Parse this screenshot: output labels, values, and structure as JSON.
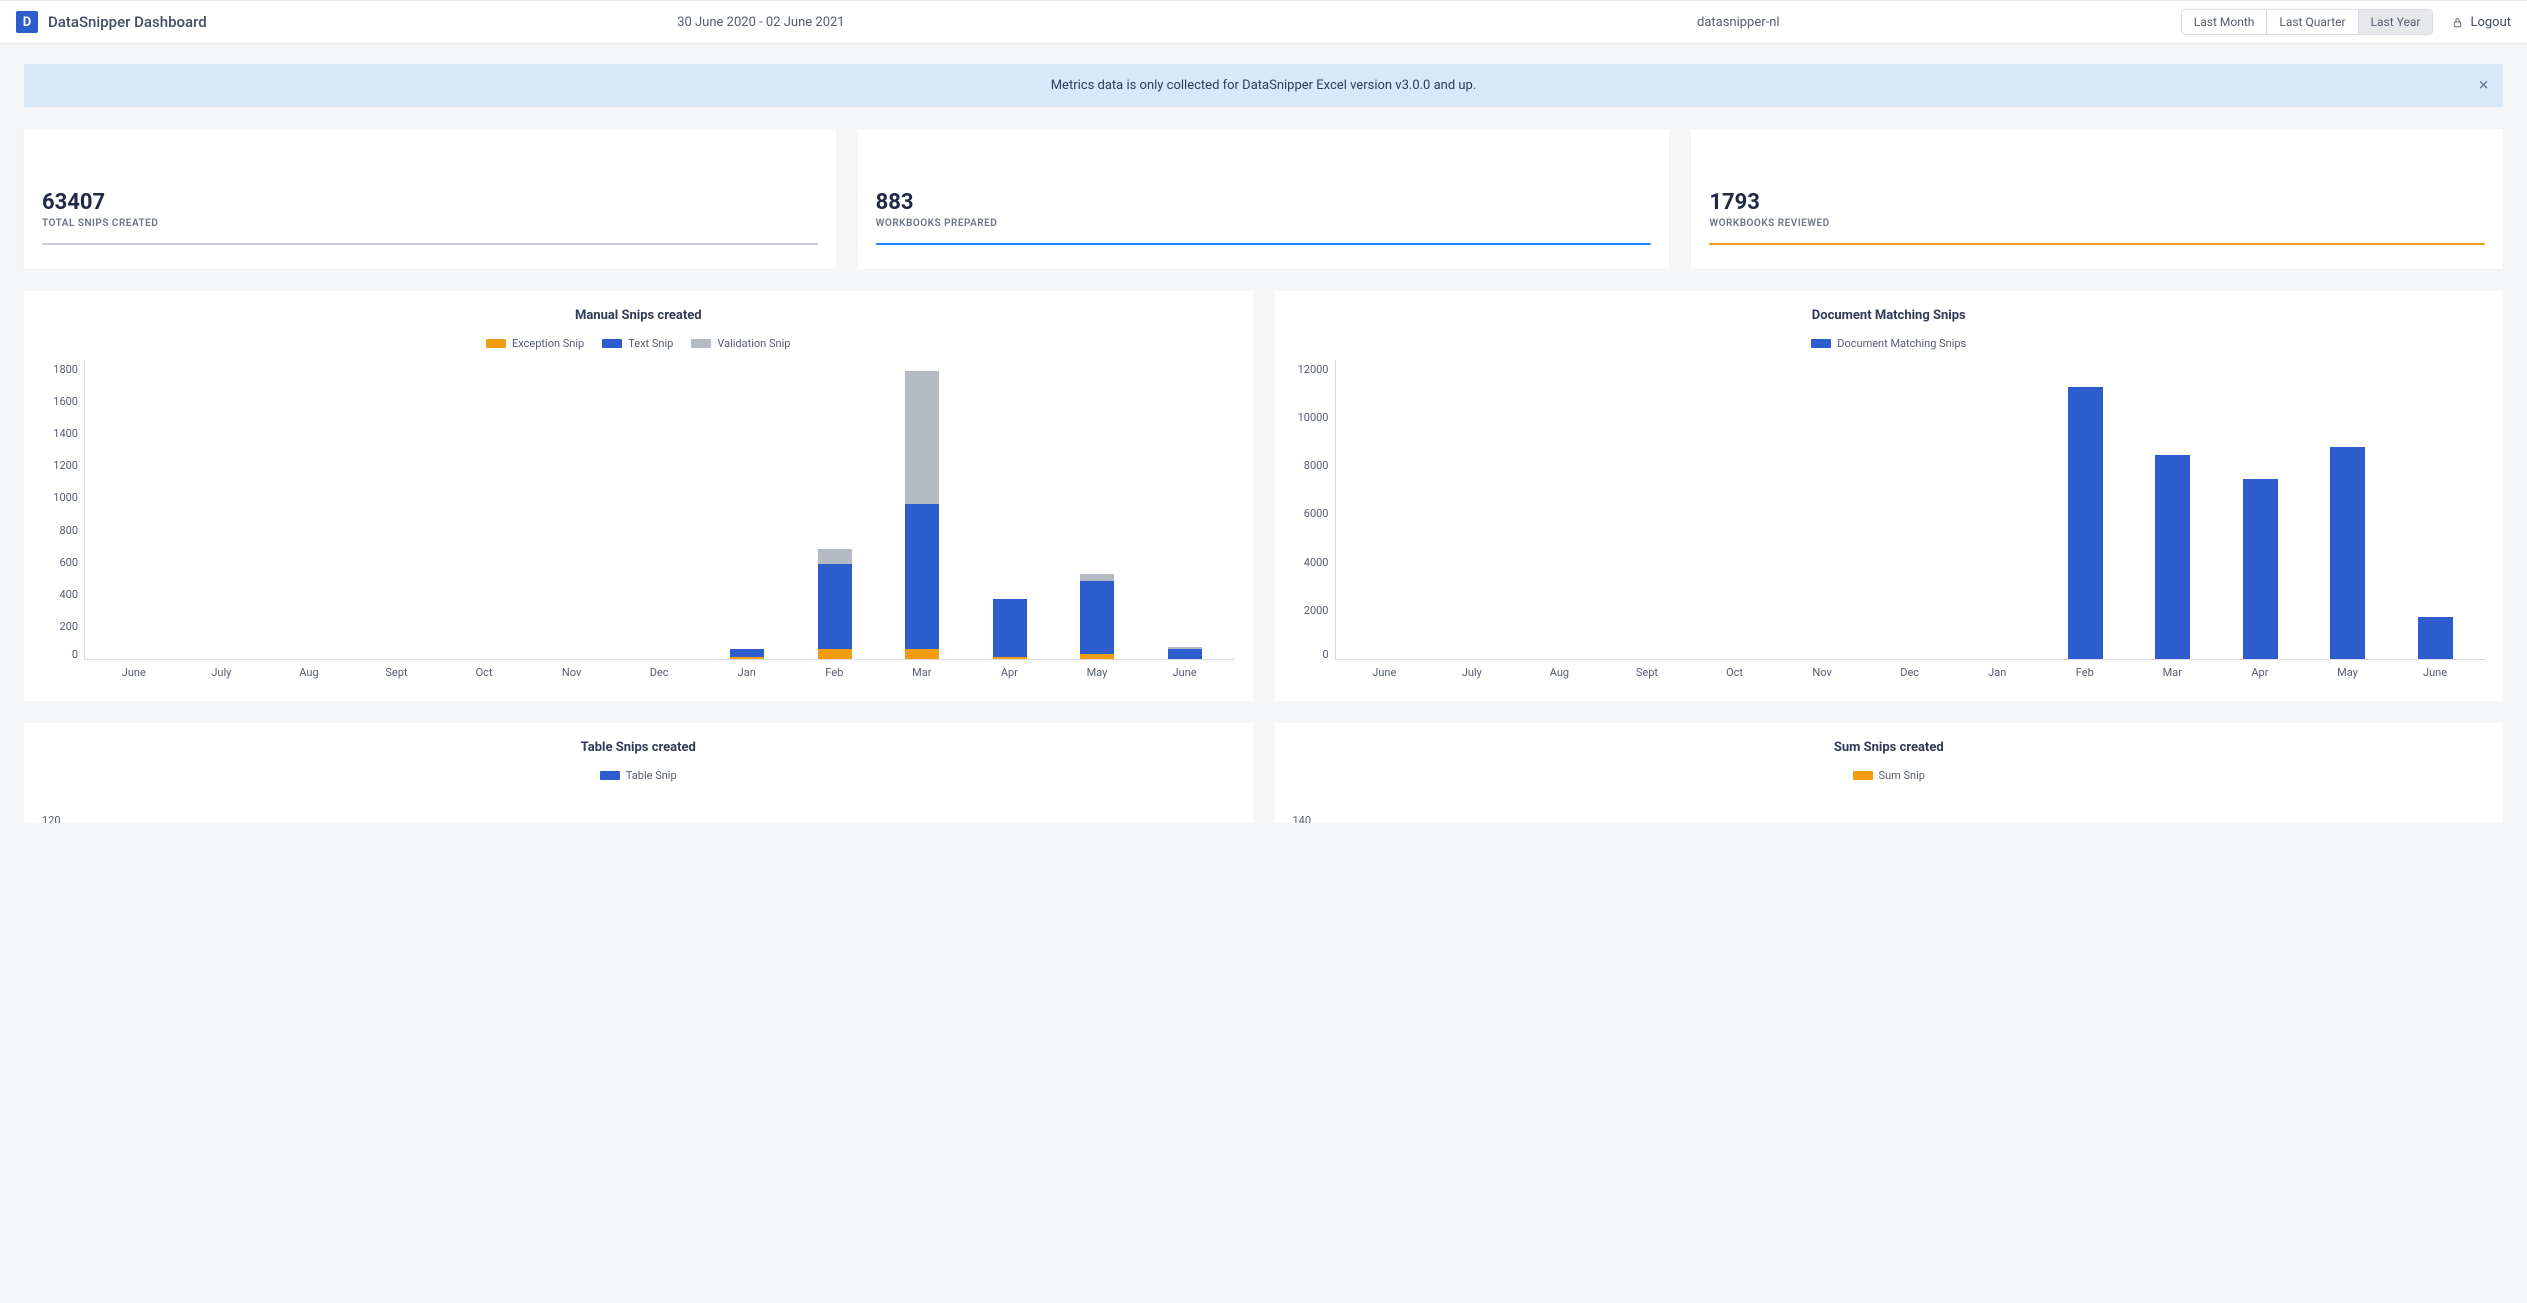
{
  "header": {
    "brand_letter": "D",
    "brand_title": "DataSnipper Dashboard",
    "date_range": "30 June 2020 - 02 June 2021",
    "tenant": "datasnipper-nl",
    "periods": [
      "Last Month",
      "Last Quarter",
      "Last Year"
    ],
    "active_period": 2,
    "logout_label": "Logout"
  },
  "notice": {
    "text": "Metrics data is only collected for DataSnipper Excel version v3.0.0 and up.",
    "close_glyph": "✕"
  },
  "summary": [
    {
      "value": "63407",
      "label": "TOTAL SNIPS CREATED",
      "line": "gray"
    },
    {
      "value": "883",
      "label": "WORKBOOKS PREPARED",
      "line": "blue"
    },
    {
      "value": "1793",
      "label": "WORKBOOKS REVIEWED",
      "line": "orange"
    }
  ],
  "charts": {
    "manual_snips": {
      "title": "Manual Snips created",
      "legend": [
        {
          "label": "Exception Snip",
          "color": "orange"
        },
        {
          "label": "Text Snip",
          "color": "blue"
        },
        {
          "label": "Validation Snip",
          "color": "gray"
        }
      ]
    },
    "doc_match": {
      "title": "Document Matching Snips",
      "legend": [
        {
          "label": "Document Matching Snips",
          "color": "blue"
        }
      ]
    },
    "table_snips": {
      "title": "Table Snips created",
      "legend": [
        {
          "label": "Table Snip",
          "color": "blue"
        }
      ],
      "visible_y_ticks": [
        "120"
      ]
    },
    "sum_snips": {
      "title": "Sum Snips created",
      "legend": [
        {
          "label": "Sum Snip",
          "color": "orange"
        }
      ],
      "visible_y_ticks": [
        "140"
      ]
    }
  },
  "chart_data": [
    {
      "id": "manual_snips",
      "type": "bar",
      "stacked": true,
      "title": "Manual Snips created",
      "xlabel": "",
      "ylabel": "",
      "ylim": [
        0,
        1800
      ],
      "y_ticks": [
        0,
        200,
        400,
        600,
        800,
        1000,
        1200,
        1400,
        1600,
        1800
      ],
      "categories": [
        "June",
        "July",
        "Aug",
        "Sept",
        "Oct",
        "Nov",
        "Dec",
        "Jan",
        "Feb",
        "Mar",
        "Apr",
        "May",
        "June"
      ],
      "series": [
        {
          "name": "Exception Snip",
          "color": "#f39c12",
          "values": [
            0,
            0,
            0,
            0,
            0,
            0,
            0,
            10,
            60,
            60,
            10,
            30,
            0
          ]
        },
        {
          "name": "Text Snip",
          "color": "#2d5dcc",
          "values": [
            0,
            0,
            0,
            0,
            0,
            0,
            0,
            50,
            510,
            870,
            350,
            440,
            60
          ]
        },
        {
          "name": "Validation Snip",
          "color": "#b5b9c3",
          "values": [
            0,
            0,
            0,
            0,
            0,
            0,
            0,
            0,
            90,
            800,
            0,
            40,
            10
          ]
        }
      ]
    },
    {
      "id": "doc_match",
      "type": "bar",
      "stacked": false,
      "title": "Document Matching Snips",
      "xlabel": "",
      "ylabel": "",
      "ylim": [
        0,
        12000
      ],
      "y_ticks": [
        0,
        2000,
        4000,
        6000,
        8000,
        10000,
        12000
      ],
      "categories": [
        "June",
        "July",
        "Aug",
        "Sept",
        "Oct",
        "Nov",
        "Dec",
        "Jan",
        "Feb",
        "Mar",
        "Apr",
        "May",
        "June"
      ],
      "series": [
        {
          "name": "Document Matching Snips",
          "color": "#2d5dcc",
          "values": [
            0,
            0,
            0,
            0,
            0,
            0,
            0,
            0,
            10900,
            8150,
            7200,
            8500,
            1700
          ]
        }
      ]
    },
    {
      "id": "table_snips",
      "type": "bar",
      "title": "Table Snips created",
      "note": "only top edge visible in screenshot",
      "ylim": [
        0,
        120
      ],
      "series": [
        {
          "name": "Table Snip",
          "color": "#2d5dcc"
        }
      ]
    },
    {
      "id": "sum_snips",
      "type": "bar",
      "title": "Sum Snips created",
      "note": "only top edge visible in screenshot",
      "ylim": [
        0,
        140
      ],
      "series": [
        {
          "name": "Sum Snip",
          "color": "#f39c12"
        }
      ]
    }
  ]
}
